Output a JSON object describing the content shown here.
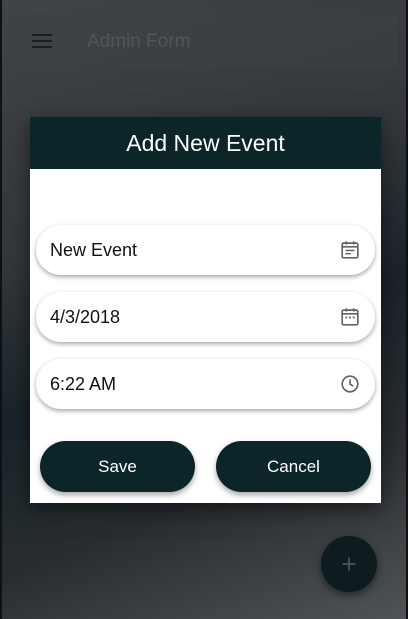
{
  "appbar": {
    "title": "Admin Form",
    "menu_icon": "hamburger-menu-icon"
  },
  "dialog": {
    "title": "Add New Event",
    "fields": [
      {
        "name": "event-name",
        "value": "New Event",
        "icon": "calendar-notes-icon"
      },
      {
        "name": "event-date",
        "value": "4/3/2018",
        "icon": "calendar-icon"
      },
      {
        "name": "event-time",
        "value": "6:22 AM",
        "icon": "clock-icon"
      }
    ],
    "save_label": "Save",
    "cancel_label": "Cancel"
  },
  "fab": {
    "label": "+",
    "icon": "plus-icon"
  },
  "colors": {
    "primary_dark": "#0b2528",
    "dialog_bg": "#ffffff",
    "icon_grey": "#5f6368"
  }
}
